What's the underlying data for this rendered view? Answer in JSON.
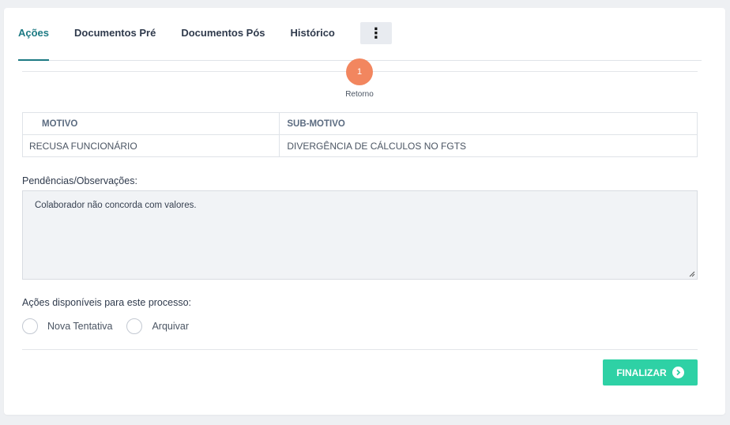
{
  "tabs": [
    {
      "label": "Ações",
      "active": true
    },
    {
      "label": "Documentos Pré",
      "active": false
    },
    {
      "label": "Documentos Pós",
      "active": false
    },
    {
      "label": "Histórico",
      "active": false
    }
  ],
  "tab_more_icon": "vertical-ellipsis-icon",
  "step": {
    "number": "1",
    "label": "Retorno"
  },
  "table": {
    "headers": [
      "MOTIVO",
      "SUB-MOTIVO"
    ],
    "row": [
      "RECUSA FUNCIONÁRIO",
      "DIVERGÊNCIA DE CÁLCULOS NO FGTS"
    ]
  },
  "observations": {
    "label": "Pendências/Observações:",
    "value": "Colaborador não concorda com valores."
  },
  "actions": {
    "label": "Ações disponíveis para este processo:",
    "options": [
      "Nova Tentativa",
      "Arquivar"
    ]
  },
  "finalize": {
    "label": "FINALIZAR",
    "icon": "chevron-right-circle-icon"
  },
  "colors": {
    "accent": "#1d7a83",
    "step": "#f2865f",
    "button": "#2ed1a5"
  }
}
